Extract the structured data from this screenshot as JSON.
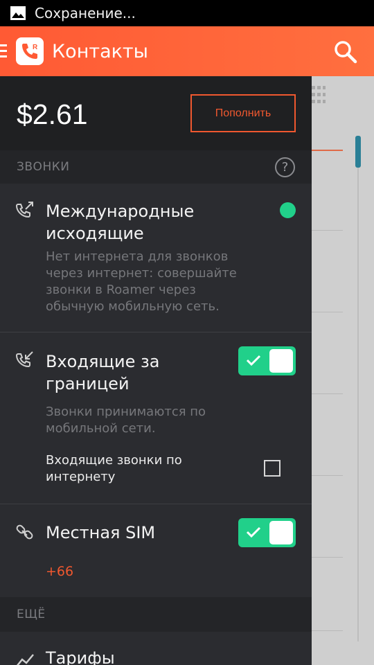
{
  "status_bar": {
    "text": "Сохранение..."
  },
  "app_bar": {
    "title": "Контакты",
    "brand_color": "#ff5a34"
  },
  "drawer": {
    "balance": "$2.61",
    "topup_label": "Пополнить",
    "calls_section": {
      "header": "ЗВОНКИ",
      "help_label": "?",
      "international": {
        "title_line1": "Международные",
        "title_line2": "исходящие",
        "desc_line1": "Нет интернета для звонков",
        "desc_line2": "через интернет: совершайте",
        "desc_line3": "звонки в Roamer через",
        "desc_line4": "обычную мобильную сеть.",
        "status": "on"
      },
      "incoming_abroad": {
        "title_line1": "Входящие за",
        "title_line2": "границей",
        "desc_line1": "Звонки принимаются по",
        "desc_line2": "мобильной сети.",
        "toggle_on": true,
        "internet_calls_label_line1": "Входящие звонки по",
        "internet_calls_label_line2": "интернету",
        "internet_calls_checked": false
      },
      "local_sim": {
        "title": "Местная SIM",
        "toggle_on": true,
        "number": "+66"
      }
    },
    "more_section": {
      "header": "ЕЩЁ",
      "tariffs_label": "Тарифы"
    }
  },
  "colors": {
    "accent": "#f0582f",
    "toggle_green": "#21d08a",
    "drawer_bg": "#2b2c30"
  }
}
